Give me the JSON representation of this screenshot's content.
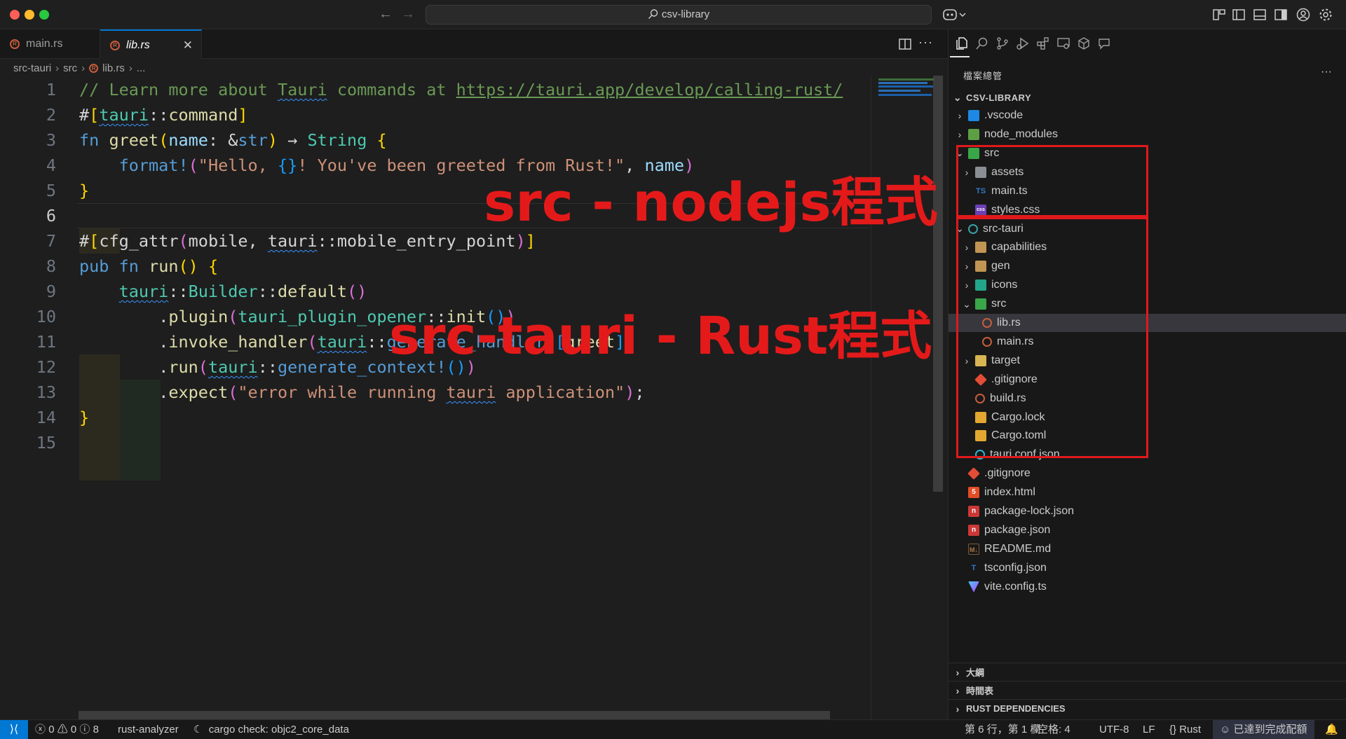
{
  "window": {
    "title": "csv-library"
  },
  "tabs": [
    {
      "label": "main.rs",
      "active": false
    },
    {
      "label": "lib.rs",
      "active": true
    }
  ],
  "breadcrumb": [
    "src-tauri",
    "src",
    "lib.rs",
    "..."
  ],
  "editor": {
    "active_line": 6,
    "line_numbers": [
      "1",
      "2",
      "3",
      "4",
      "5",
      "6",
      "7",
      "8",
      "9",
      "10",
      "11",
      "12",
      "13",
      "14",
      "15"
    ]
  },
  "explorer": {
    "title": "檔案總管",
    "root": "CSV-LIBRARY",
    "items": [
      {
        "label": ".vscode",
        "icon": "vscode-folder-icon",
        "depth": 1,
        "folder": true,
        "open": false
      },
      {
        "label": "node_modules",
        "icon": "node-folder-icon",
        "depth": 1,
        "folder": true,
        "open": false
      },
      {
        "label": "src",
        "icon": "src-folder-icon",
        "depth": 1,
        "folder": true,
        "open": true
      },
      {
        "label": "assets",
        "icon": "assets-folder-icon",
        "depth": 2,
        "folder": true,
        "open": false
      },
      {
        "label": "main.ts",
        "icon": "typescript-icon",
        "depth": 2,
        "folder": false
      },
      {
        "label": "styles.css",
        "icon": "css-icon",
        "depth": 2,
        "folder": false
      },
      {
        "label": "src-tauri",
        "icon": "tauri-folder-icon",
        "depth": 1,
        "folder": true,
        "open": true
      },
      {
        "label": "capabilities",
        "icon": "folder-icon",
        "depth": 2,
        "folder": true,
        "open": false
      },
      {
        "label": "gen",
        "icon": "folder-icon",
        "depth": 2,
        "folder": true,
        "open": false
      },
      {
        "label": "icons",
        "icon": "images-folder-icon",
        "depth": 2,
        "folder": true,
        "open": false
      },
      {
        "label": "src",
        "icon": "src-folder-icon",
        "depth": 2,
        "folder": true,
        "open": true
      },
      {
        "label": "lib.rs",
        "icon": "rust-icon",
        "depth": 3,
        "folder": false,
        "selected": true
      },
      {
        "label": "main.rs",
        "icon": "rust-icon",
        "depth": 3,
        "folder": false
      },
      {
        "label": "target",
        "icon": "target-folder-icon",
        "depth": 2,
        "folder": true,
        "open": false
      },
      {
        "label": ".gitignore",
        "icon": "git-icon",
        "depth": 2,
        "folder": false
      },
      {
        "label": "build.rs",
        "icon": "rust-icon",
        "depth": 2,
        "folder": false
      },
      {
        "label": "Cargo.lock",
        "icon": "cargo-icon",
        "depth": 2,
        "folder": false
      },
      {
        "label": "Cargo.toml",
        "icon": "cargo-icon",
        "depth": 2,
        "folder": false
      },
      {
        "label": "tauri.conf.json",
        "icon": "json-icon",
        "depth": 2,
        "folder": false
      },
      {
        "label": ".gitignore",
        "icon": "git-icon",
        "depth": 1,
        "folder": false
      },
      {
        "label": "index.html",
        "icon": "html-icon",
        "depth": 1,
        "folder": false
      },
      {
        "label": "package-lock.json",
        "icon": "npm-icon",
        "depth": 1,
        "folder": false
      },
      {
        "label": "package.json",
        "icon": "npm-icon",
        "depth": 1,
        "folder": false
      },
      {
        "label": "README.md",
        "icon": "markdown-icon",
        "depth": 1,
        "folder": false
      },
      {
        "label": "tsconfig.json",
        "icon": "tsconfig-icon",
        "depth": 1,
        "folder": false
      },
      {
        "label": "vite.config.ts",
        "icon": "vite-icon",
        "depth": 1,
        "folder": false
      }
    ],
    "sections": [
      "大綱",
      "時間表",
      "RUST DEPENDENCIES"
    ]
  },
  "annotations": {
    "src": "src - nodejs程式",
    "src_tauri": "src-tauri - Rust程式",
    "color": "#e0191c"
  },
  "status": {
    "errors": "0",
    "warnings": "0",
    "infos": "8",
    "language_server": "rust-analyzer",
    "task": "cargo check: objc2_core_data",
    "position": "第 6 行，第 1 欄",
    "indent": "空格: 4",
    "encoding": "UTF-8",
    "eol": "LF",
    "language": "Rust",
    "quota": "已達到完成配額"
  },
  "colors": {
    "accent": "#0078d4",
    "annotation": "#e0191c"
  }
}
